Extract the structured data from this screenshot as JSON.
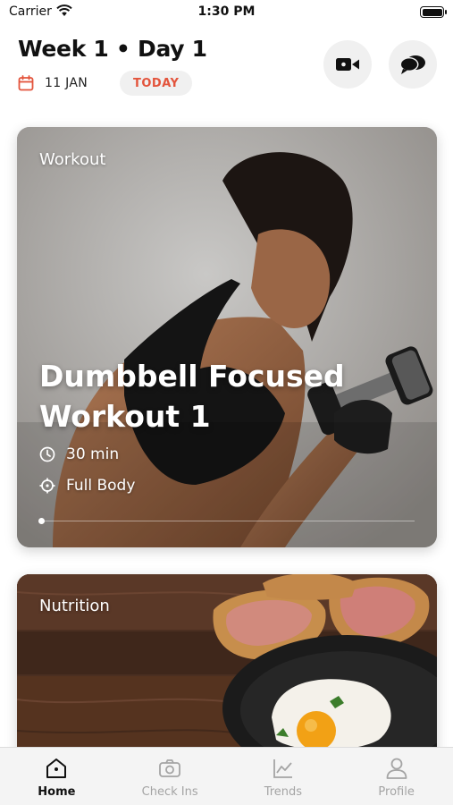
{
  "status_bar": {
    "carrier": "Carrier",
    "time": "1:30 PM"
  },
  "header": {
    "title": "Week 1 • Day 1",
    "date": "11 JAN",
    "today_label": "TODAY",
    "actions": [
      "video-icon",
      "chat-icon"
    ]
  },
  "cards": {
    "workout": {
      "tag": "Workout",
      "title": "Dumbbell Focused Workout 1",
      "duration": "30 min",
      "focus": "Full Body",
      "progress": 0
    },
    "nutrition": {
      "tag": "Nutrition"
    }
  },
  "tabs": [
    {
      "label": "Home",
      "icon": "home-icon",
      "active": true
    },
    {
      "label": "Check Ins",
      "icon": "camera-icon",
      "active": false
    },
    {
      "label": "Trends",
      "icon": "chart-icon",
      "active": false
    },
    {
      "label": "Profile",
      "icon": "person-icon",
      "active": false
    }
  ],
  "colors": {
    "accent": "#e3543c",
    "active_tab": "#111111",
    "inactive_tab": "#a4a4a4"
  }
}
